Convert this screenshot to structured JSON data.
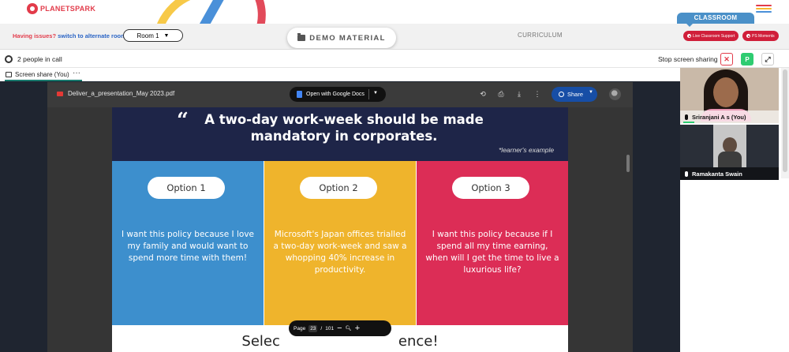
{
  "header": {
    "brand": "PLANETSPARK",
    "issues_prefix": "Having issues?",
    "issues_link": "switch to alternate room",
    "room_value": "Room 1",
    "demo_material": "DEMO MATERIAL",
    "curriculum": "CURRICULUM",
    "classroom_tab": "CLASSROOM",
    "live_support": "Live Classroom Support",
    "ps_moments": "PS Moments",
    "colors": {
      "brand": "#e23b4a",
      "accent": "#4a90c8",
      "pill": "#d01f3a"
    }
  },
  "callbar": {
    "people_in_call": "2 people in call",
    "stop_sharing": "Stop screen sharing",
    "p_badge": "P"
  },
  "screenshare": {
    "label": "Screen share (You)",
    "more": "···"
  },
  "viewer": {
    "file_name": "Deliver_a_presentation_May 2023.pdf",
    "open_with": "Open with Google Docs",
    "share": "Share",
    "page_label": "Page",
    "page_current": "23",
    "page_sep": "/",
    "page_total": "101",
    "zoom_out": "−",
    "zoom_in": "+"
  },
  "slide": {
    "quote_mark": "“",
    "title": "A two-day work-week should be made mandatory in corporates.",
    "note": "*learner's example",
    "options": [
      {
        "label": "Option 1",
        "text": "I want this policy because I love my family and would want to spend more time with them!"
      },
      {
        "label": "Option 2",
        "text": "Microsoft's Japan offices trialled a two-day work-week and saw a whopping 40% increase in productivity."
      },
      {
        "label": "Option 3",
        "text": "I want this policy because if I spend all my time earning, when will I get the time to live a luxurious life?"
      }
    ],
    "footer_visible": "Selec",
    "footer_tail": "ence!",
    "colors": {
      "header": "#1e2548",
      "option1": "#3d8fcd",
      "option2": "#efb42c",
      "option3": "#dc2d56"
    }
  },
  "participants": [
    {
      "name": "Sriranjani A s (You)"
    },
    {
      "name": "Ramakanta Swain"
    }
  ]
}
